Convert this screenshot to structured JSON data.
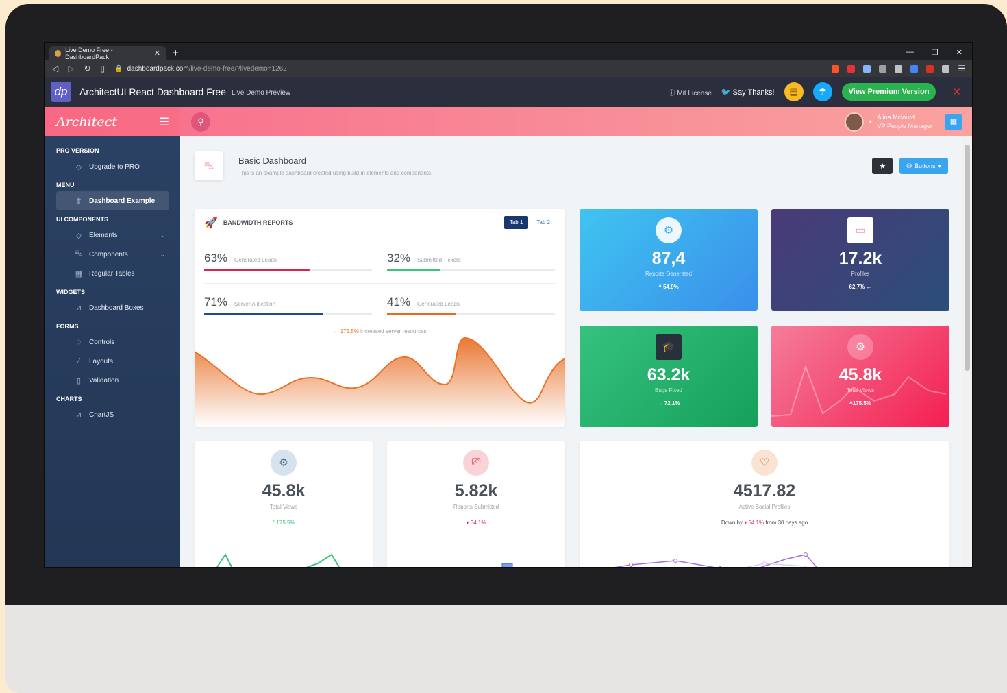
{
  "browser": {
    "tab_title": "Live Demo Free - DashboardPack",
    "url_host": "dashboardpack.com",
    "url_path": "/live-demo-free/?livedemo=1262"
  },
  "demo_header": {
    "logo": "dp",
    "title": "ArchitectUI React Dashboard Free",
    "subtitle": "Live Demo Preview",
    "license": "Mit License",
    "say_thanks": "Say Thanks!",
    "premium": "View Premium Version"
  },
  "app": {
    "logo": "Architect",
    "user": {
      "name": "Alina Mclourd",
      "role": "VP People Manager"
    }
  },
  "sidebar": {
    "sections": [
      {
        "title": "PRO VERSION",
        "items": [
          {
            "label": "Upgrade to PRO",
            "icon": "diamond-icon"
          }
        ]
      },
      {
        "title": "MENU",
        "items": [
          {
            "label": "Dashboard Example",
            "icon": "rocket-icon",
            "active": true
          }
        ]
      },
      {
        "title": "UI COMPONENTS",
        "items": [
          {
            "label": "Elements",
            "icon": "diamond-icon"
          },
          {
            "label": "Components",
            "icon": "car-icon"
          },
          {
            "label": "Regular Tables",
            "icon": "display-icon"
          }
        ]
      },
      {
        "title": "WIDGETS",
        "items": [
          {
            "label": "Dashboard Boxes",
            "icon": "graph-icon"
          }
        ]
      },
      {
        "title": "FORMS",
        "items": [
          {
            "label": "Controls",
            "icon": "light-icon"
          },
          {
            "label": "Layouts",
            "icon": "eyedropper-icon"
          },
          {
            "label": "Validation",
            "icon": "pendrive-icon"
          }
        ]
      },
      {
        "title": "CHARTS",
        "items": [
          {
            "label": "ChartJS",
            "icon": "graph2-icon"
          }
        ]
      }
    ]
  },
  "page": {
    "title": "Basic Dashboard",
    "description": "This is an example dashboard created using build-in elements and components.",
    "buttons_label": "Buttons"
  },
  "bandwidth": {
    "title": "BANDWIDTH REPORTS",
    "tab1": "Tab 1",
    "tab2": "Tab 2",
    "progress": [
      {
        "pct": "63%",
        "label": "Generated Leads",
        "value": 0.63,
        "color": "#d92550"
      },
      {
        "pct": "32%",
        "label": "Submitted Tickers",
        "value": 0.32,
        "color": "#3ac47d"
      },
      {
        "pct": "71%",
        "label": "Server Allocation",
        "value": 0.71,
        "color": "#1c4c8c"
      },
      {
        "pct": "41%",
        "label": "Generated Leads",
        "value": 0.41,
        "color": "#e86a1a"
      }
    ],
    "note_value": "175.5%",
    "note_text": "increased server resources"
  },
  "stats": [
    {
      "value": "87,4",
      "desc": "Reports Generated",
      "change": "54.9%"
    },
    {
      "value": "17.2k",
      "desc": "Profiles",
      "change": "62,7%"
    },
    {
      "value": "63.2k",
      "desc": "Bugs Fixed",
      "change": "72.1%"
    },
    {
      "value": "45.8k",
      "desc": "Total Views",
      "change": "175.5%"
    }
  ],
  "mini": [
    {
      "value": "45.8k",
      "desc": "Total Views",
      "change": "175.5%"
    },
    {
      "value": "5.82k",
      "desc": "Reports Submitted",
      "change": "54.1%"
    },
    {
      "value": "4517.82",
      "desc": "Active Social Profiles",
      "change_prefix": "Down by",
      "change": "54.1%",
      "change_suffix": "from 30 days ago"
    }
  ]
}
